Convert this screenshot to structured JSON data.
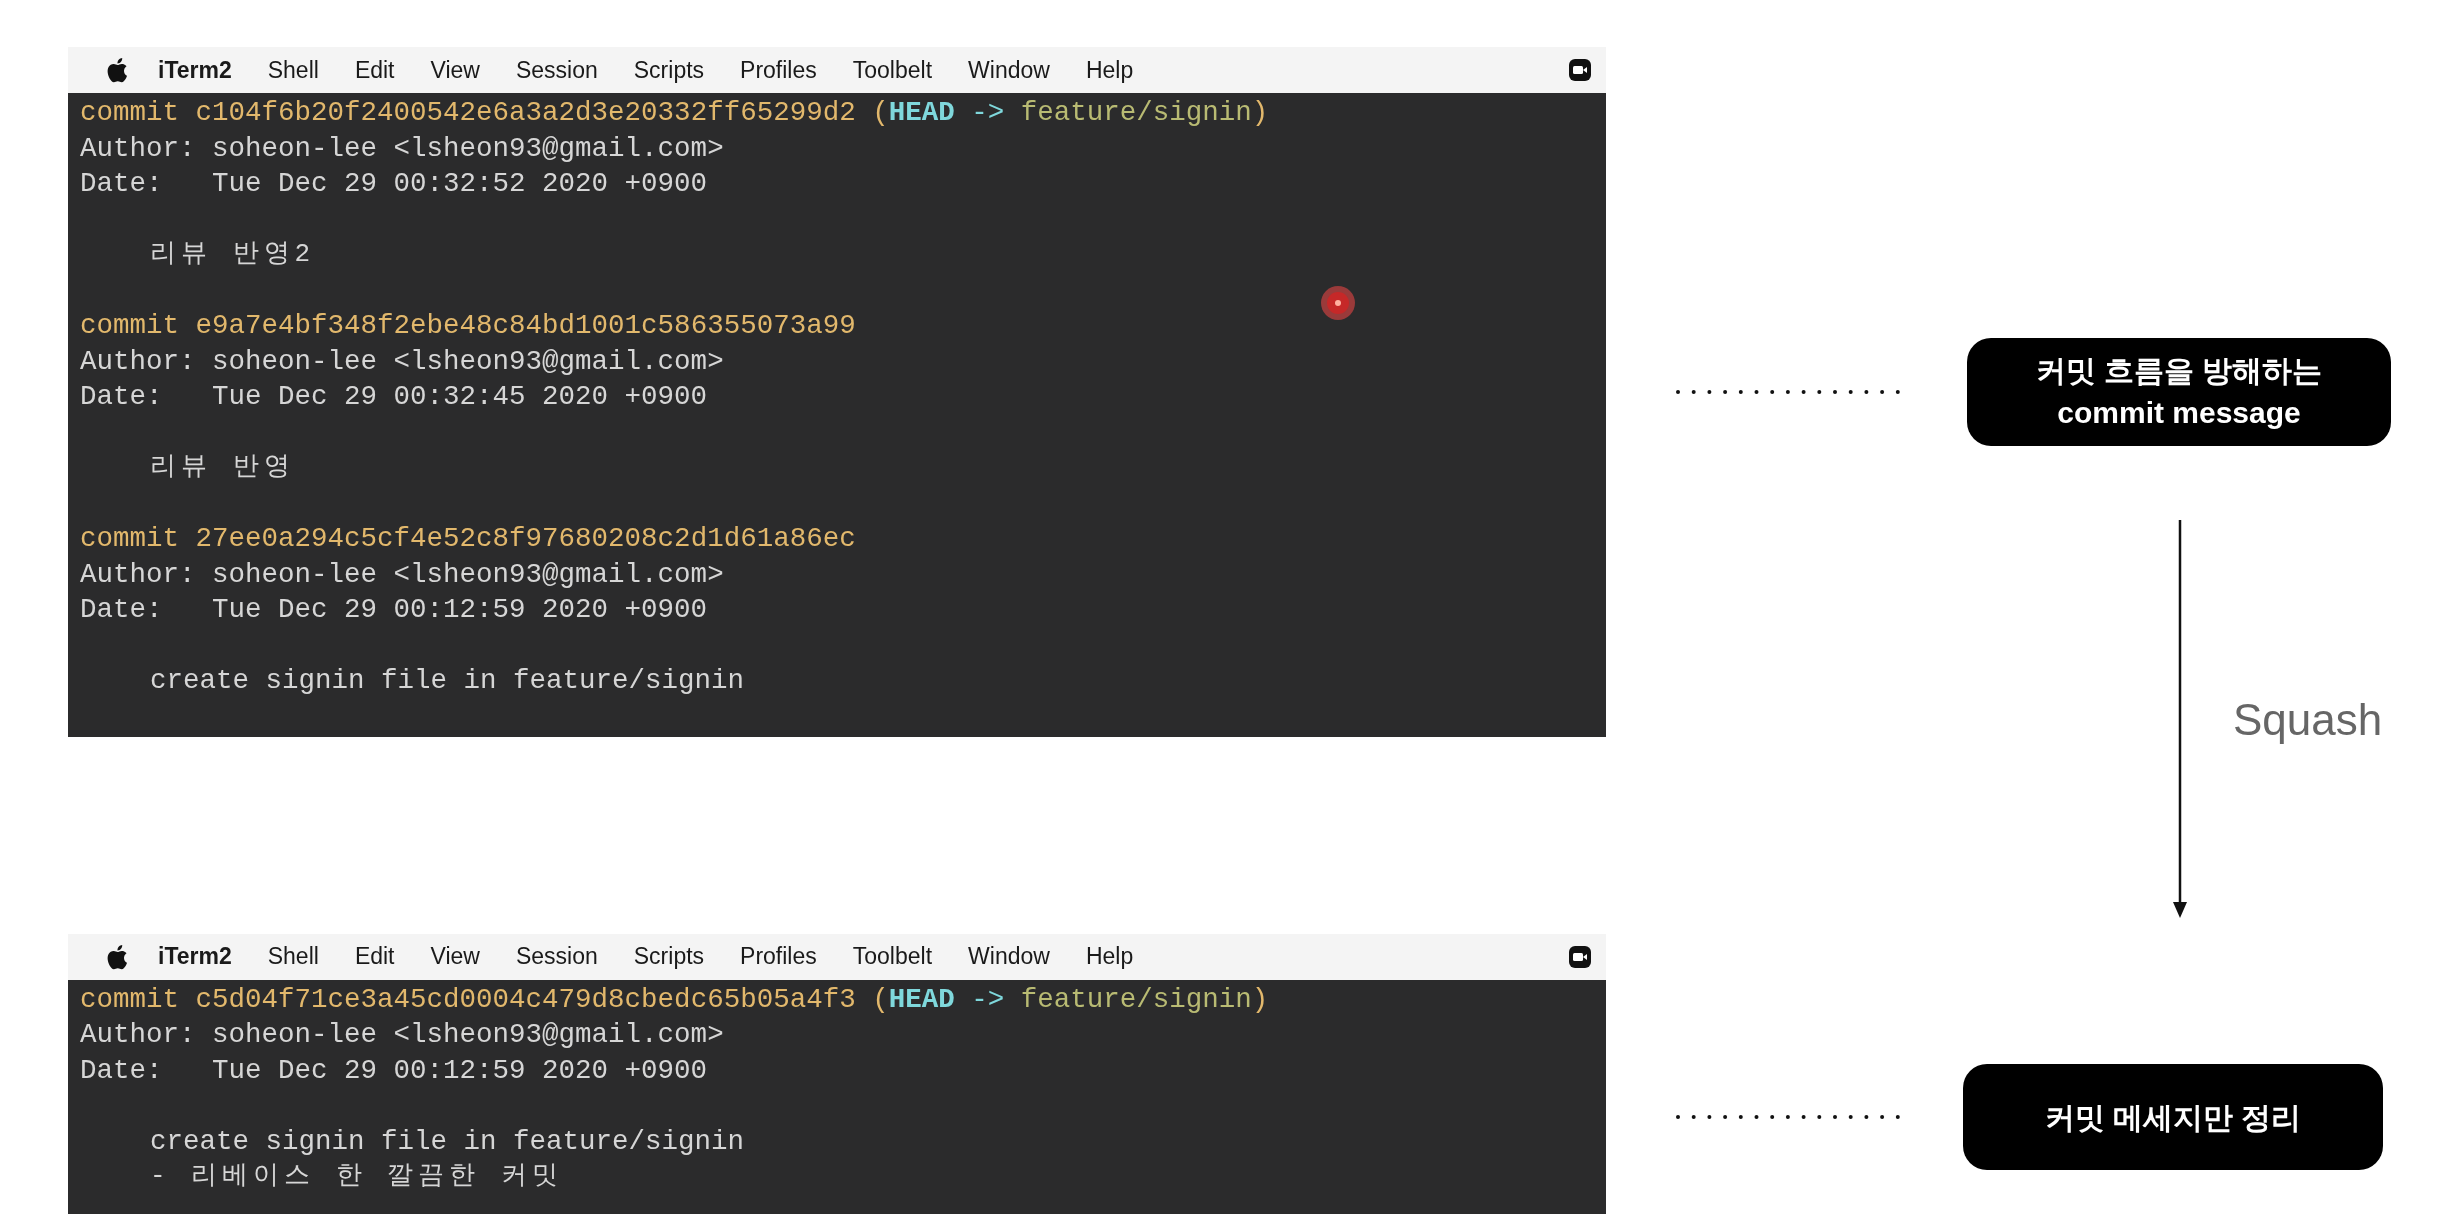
{
  "windows": [
    {
      "menu_bar": {
        "app": "iTerm2",
        "items": [
          "Shell",
          "Edit",
          "View",
          "Session",
          "Scripts",
          "Profiles",
          "Toolbelt",
          "Window",
          "Help"
        ]
      },
      "cursor_marker": true,
      "commits": [
        {
          "label": "commit",
          "hash": "c104f6b20f2400542e6a3a2d3e20332ff65299d2",
          "ref": {
            "open": "(",
            "head": "HEAD",
            "arrow": "->",
            "branch": "feature/signin",
            "close": ")"
          },
          "author_label": "Author:",
          "author": "soheon-lee <lsheon93@gmail.com>",
          "date_label": "Date:",
          "date": "Tue Dec 29 00:32:52 2020 +0900",
          "message": [
            {
              "text": "리뷰 반영2",
              "kind": "korean"
            }
          ]
        },
        {
          "label": "commit",
          "hash": "e9a7e4bf348f2ebe48c84bd1001c586355073a99",
          "author_label": "Author:",
          "author": "soheon-lee <lsheon93@gmail.com>",
          "date_label": "Date:",
          "date": "Tue Dec 29 00:32:45 2020 +0900",
          "message": [
            {
              "text": "리뷰 반영",
              "kind": "korean"
            }
          ]
        },
        {
          "label": "commit",
          "hash": "27ee0a294c5cf4e52c8f97680208c2d1d61a86ec",
          "author_label": "Author:",
          "author": "soheon-lee <lsheon93@gmail.com>",
          "date_label": "Date:",
          "date": "Tue Dec 29 00:12:59 2020 +0900",
          "message": [
            {
              "text": "create signin file in feature/signin",
              "kind": "plain"
            }
          ]
        }
      ]
    },
    {
      "menu_bar": {
        "app": "iTerm2",
        "items": [
          "Shell",
          "Edit",
          "View",
          "Session",
          "Scripts",
          "Profiles",
          "Toolbelt",
          "Window",
          "Help"
        ]
      },
      "commits": [
        {
          "label": "commit",
          "hash": "c5d04f71ce3a45cd0004c479d8cbedc65b05a4f3",
          "ref": {
            "open": "(",
            "head": "HEAD",
            "arrow": "->",
            "branch": "feature/signin",
            "close": ")"
          },
          "author_label": "Author:",
          "author": "soheon-lee <lsheon93@gmail.com>",
          "date_label": "Date:",
          "date": "Tue Dec 29 00:12:59 2020 +0900",
          "message": [
            {
              "text": "create signin file in feature/signin",
              "kind": "plain"
            },
            {
              "text": "- 리베이스 한 깔끔한 커밋",
              "kind": "korean"
            }
          ]
        }
      ]
    }
  ],
  "annotations": {
    "top_note": [
      "커밋 흐름을 방해하는",
      "commit message"
    ],
    "arrow_label": "Squash",
    "bottom_note": [
      "커밋 메세지만 정리"
    ]
  }
}
